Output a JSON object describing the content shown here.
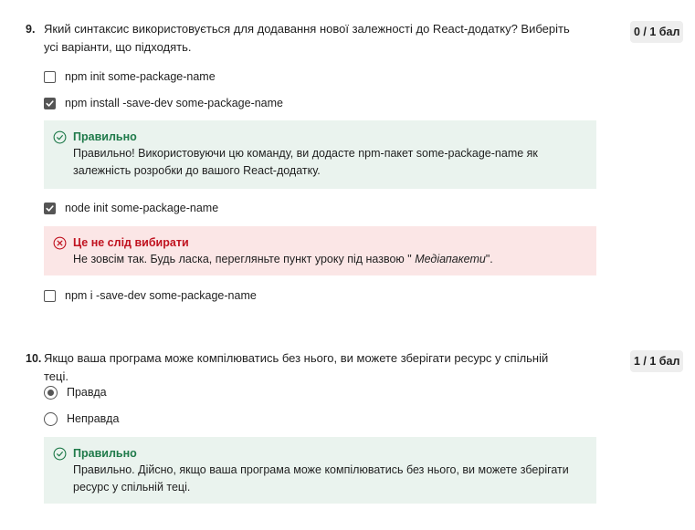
{
  "q9": {
    "number": "9.",
    "text": "Який синтаксис використовується для додавання нової залежності до React-додатку? Виберіть усі варіанти, що підходять.",
    "score": "0 / 1 бал",
    "options": [
      {
        "label": "npm init some-package-name",
        "checked": false
      },
      {
        "label": "npm install -save-dev some-package-name",
        "checked": true
      },
      {
        "label": "node init some-package-name",
        "checked": true
      },
      {
        "label": "npm i -save-dev some-package-name",
        "checked": false
      }
    ],
    "feedback_correct": {
      "title": "Правильно",
      "text": "Правильно! Використовуючи цю команду, ви додасте npm-пакет some-package-name як залежність розробки до вашого React-додатку."
    },
    "feedback_wrong": {
      "title": "Це не слід вибирати",
      "text_before": "Не зовсім так. Будь ласка, перегляньте пункт уроку під назвою \" ",
      "text_em": "Медіапакети",
      "text_after": "\"."
    }
  },
  "q10": {
    "number": "10.",
    "text": "Якщо ваша програма може компілюватись без нього, ви можете зберігати ресурс у спільній теці.",
    "score": "1 / 1 бал",
    "options": [
      {
        "label": "Правда",
        "selected": true
      },
      {
        "label": "Неправда",
        "selected": false
      }
    ],
    "feedback_correct": {
      "title": "Правильно",
      "text": "Правильно. Дійсно, якщо ваша програма може компілюватись без нього, ви можете зберігати ресурс у спільній теці."
    }
  },
  "colors": {
    "correct": "#1f7a4a",
    "wrong": "#c0121f",
    "correct_bg": "#eaf3ee",
    "wrong_bg": "#fbe6e6"
  },
  "icons": {
    "correct": "check-circle-icon",
    "wrong": "x-circle-icon",
    "checkbox": "checkbox-check-icon"
  }
}
